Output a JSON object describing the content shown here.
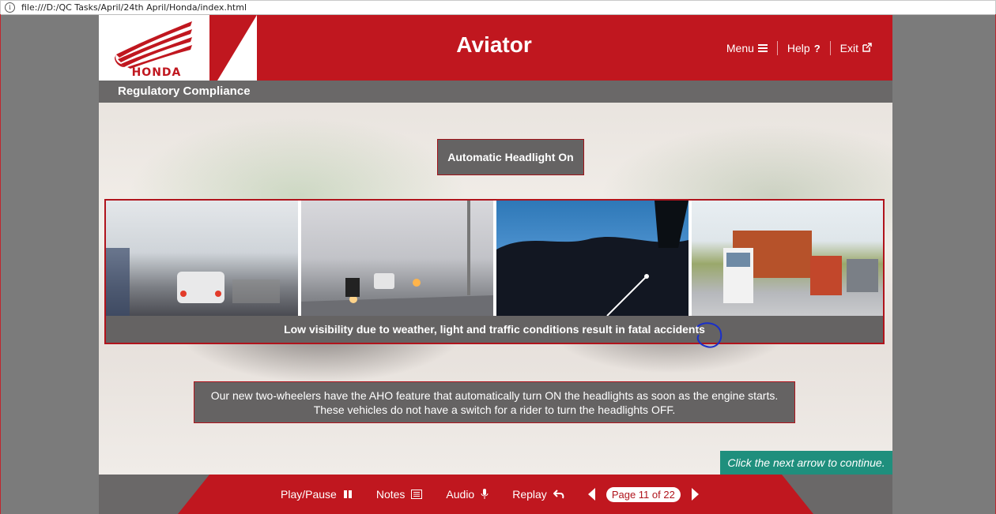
{
  "browser": {
    "url": "file:///D:/QC Tasks/April/24th April/Honda/index.html"
  },
  "header": {
    "logo_text": "HONDA",
    "title": "Aviator",
    "nav": [
      {
        "label": "Menu",
        "icon": "hamburger-icon"
      },
      {
        "label": "Help",
        "icon": "question-icon"
      },
      {
        "label": "Exit",
        "icon": "external-link-icon"
      }
    ]
  },
  "subheader": {
    "title": "Regulatory Compliance"
  },
  "slide": {
    "heading": "Automatic Headlight On",
    "image_caption": "Low visibility due to weather, light and traffic conditions result in fatal accidents",
    "body_line1": "Our new two-wheelers have the AHO feature that automatically turn ON the headlights as soon as the engine starts.",
    "body_line2": "These vehicles do not have a switch for a rider to turn the headlights OFF.",
    "hint": "Click the next arrow to continue."
  },
  "footer": {
    "play_pause": "Play/Pause",
    "notes": "Notes",
    "audio": "Audio",
    "replay": "Replay",
    "page_label": "Page 11 of 22"
  },
  "colors": {
    "brand_red": "#c0171f",
    "panel_gray": "#656363",
    "hint_teal": "#1f8f7d",
    "annotation_blue": "#1a2fc9"
  }
}
